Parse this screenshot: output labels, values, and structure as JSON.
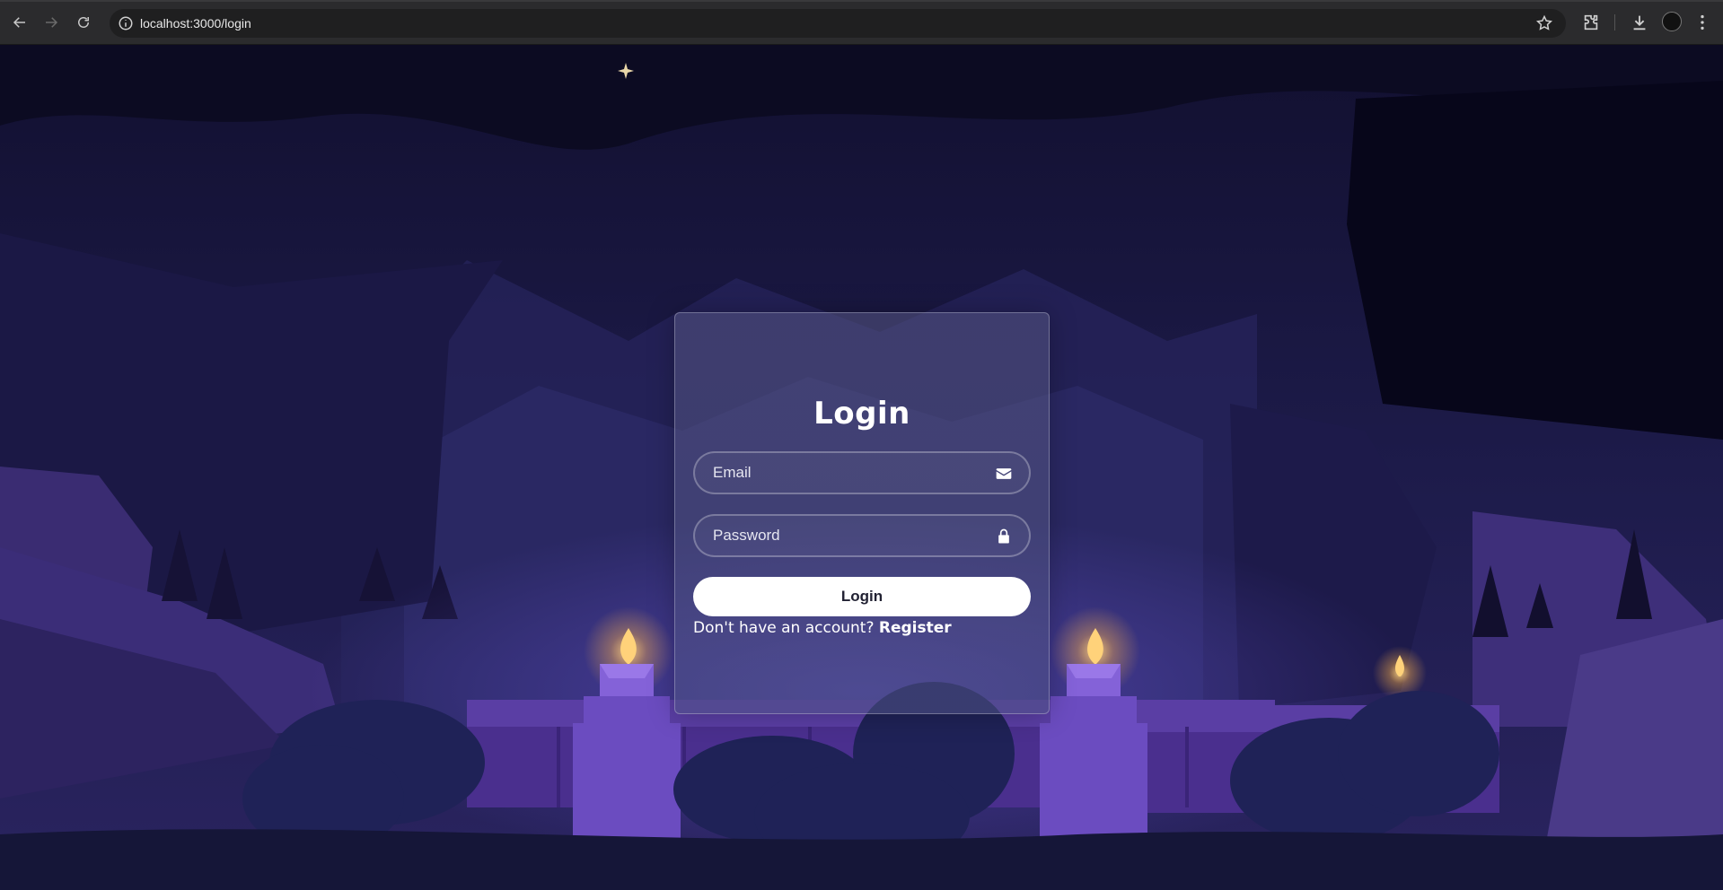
{
  "browser": {
    "url": "localhost:3000/login",
    "icons": {
      "back": "arrow-left-icon",
      "forward": "arrow-right-icon",
      "reload": "reload-icon",
      "site_info": "info-icon",
      "bookmark": "star-icon",
      "extensions": "puzzle-icon",
      "downloads": "download-icon",
      "menu": "kebab-menu-icon"
    }
  },
  "login": {
    "title": "Login",
    "email_placeholder": "Email",
    "password_placeholder": "Password",
    "submit_label": "Login",
    "no_account_text": "Don't have an account? ",
    "register_label": "Register"
  },
  "colors": {
    "card_border": "#8a8aa8",
    "button_bg": "#ffffff",
    "scene_sky": "#1b1942",
    "torch_flame": "#ffd27a",
    "wall": "#5b3fa6"
  }
}
